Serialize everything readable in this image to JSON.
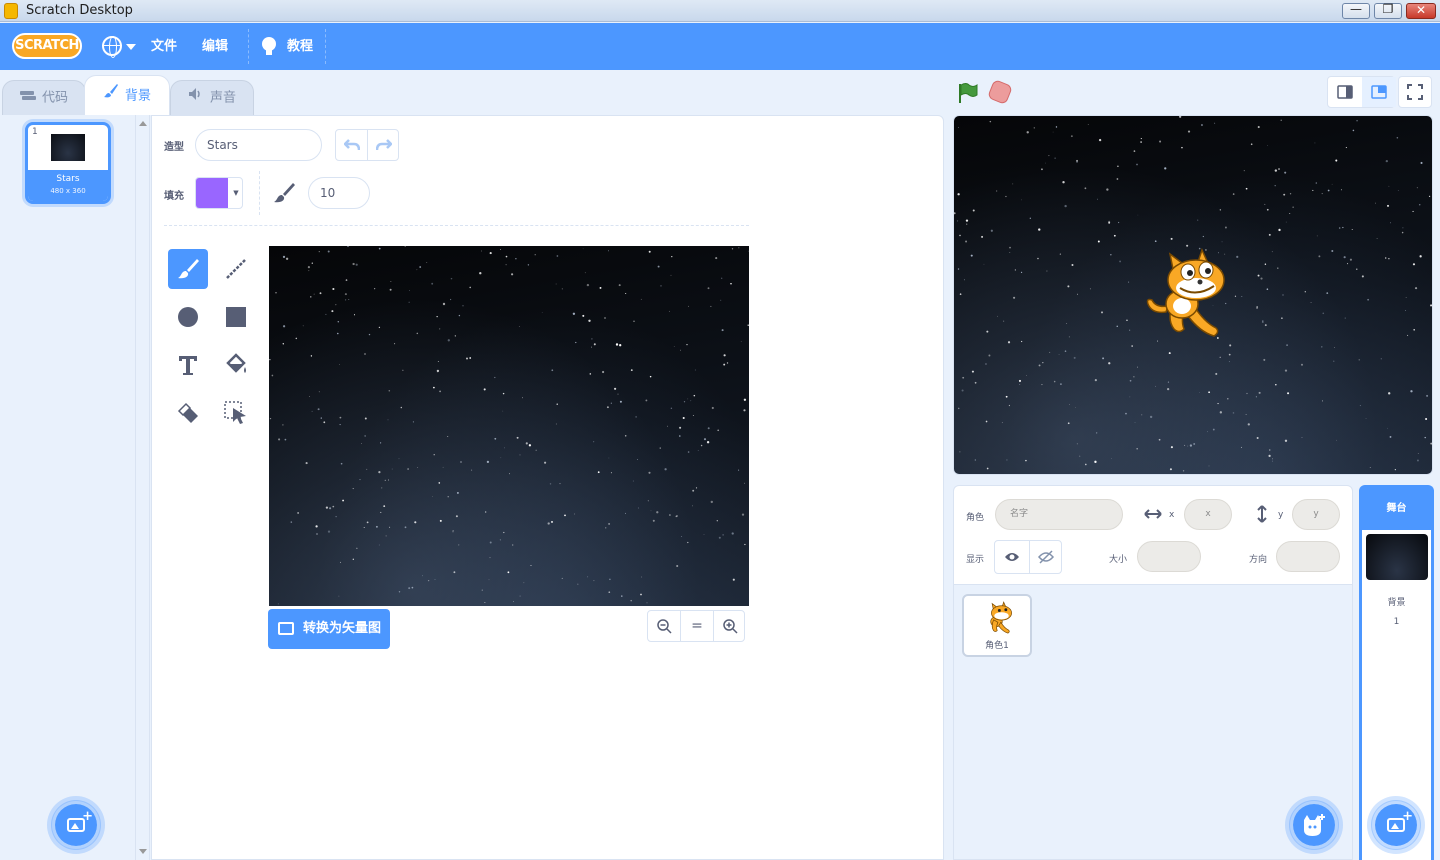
{
  "window": {
    "title": "Scratch Desktop",
    "min_glyph": "—",
    "max_glyph": "❐",
    "close_glyph": "✕"
  },
  "menubar": {
    "logo_text": "SCRATCH",
    "file": "文件",
    "edit": "编辑",
    "tutorials": "教程"
  },
  "tabs": [
    {
      "label": "代码",
      "icon": "code-icon"
    },
    {
      "label": "背景",
      "icon": "brush-icon",
      "active": true
    },
    {
      "label": "声音",
      "icon": "speaker-icon"
    }
  ],
  "costumes": [
    {
      "index": "1",
      "name": "Stars",
      "size": "480 x 360",
      "selected": true
    }
  ],
  "paint": {
    "costume_label": "造型",
    "costume_name": "Stars",
    "fill_label": "填充",
    "fill_color": "#9966ff",
    "brush_size": "10",
    "convert_button": "转换为矢量图",
    "zoom_reset": "="
  },
  "sprite_info": {
    "sprite_label": "角色",
    "name_placeholder": "名字",
    "x_label": "x",
    "x_placeholder": "x",
    "y_label": "y",
    "y_placeholder": "y",
    "show_label": "显示",
    "size_label": "大小",
    "direction_label": "方向"
  },
  "sprites": [
    {
      "name": "角色1"
    }
  ],
  "stage_pane": {
    "header": "舞台",
    "backdrop_label": "背景",
    "backdrop_count": "1"
  },
  "colors": {
    "accent": "#4c97ff",
    "tab_bg": "#d9e3f2",
    "text": "#575e75",
    "flag": "#45993d",
    "stop": "#ec9c9c"
  }
}
